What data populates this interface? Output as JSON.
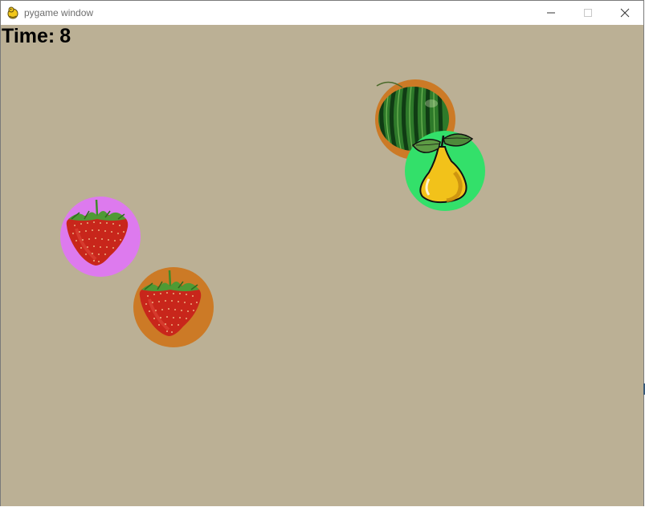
{
  "window": {
    "title": "pygame window",
    "icons": {
      "app": "pygame-snake-icon",
      "minimize": "minimize-icon",
      "maximize": "maximize-icon",
      "close": "close-icon"
    }
  },
  "game": {
    "background": "#bbb095",
    "timer": {
      "label": "Time:",
      "value": "8"
    },
    "fruits": [
      {
        "kind": "watermelon",
        "icon": "watermelon-icon",
        "ring_color": "#cc7a26"
      },
      {
        "kind": "pear",
        "icon": "pear-icon",
        "ring_color": "#33e06a"
      },
      {
        "kind": "strawberry",
        "icon": "strawberry-icon",
        "ring_color": "#dd7aee"
      },
      {
        "kind": "strawberry",
        "icon": "strawberry-icon",
        "ring_color": "#cc7a26"
      }
    ]
  }
}
